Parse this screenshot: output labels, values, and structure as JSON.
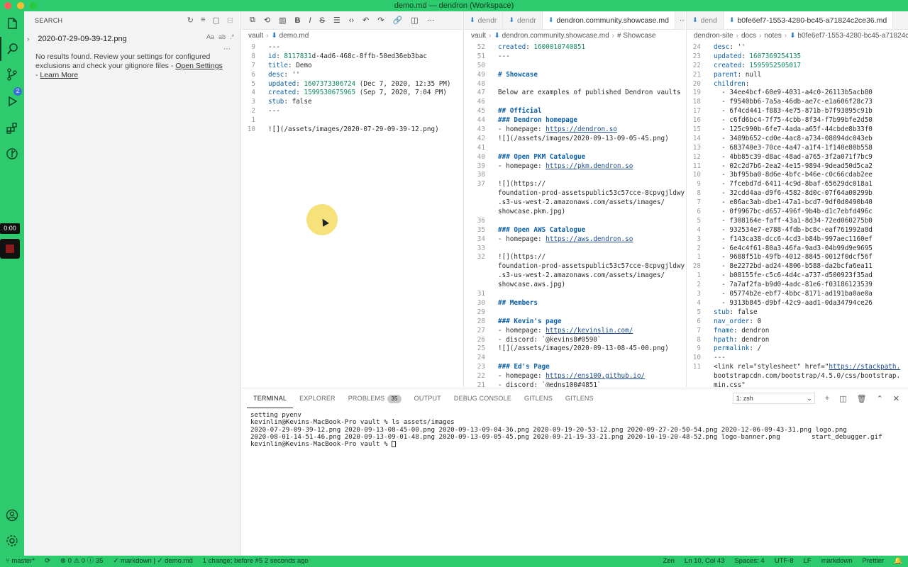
{
  "window": {
    "title": "demo.md — dendron (Workspace)"
  },
  "colors": {
    "accent": "#2dca6e",
    "badge": "#3b6fd4"
  },
  "activity": {
    "icons": [
      "files-icon",
      "search-icon",
      "source-control-icon",
      "run-debug-icon",
      "extensions-icon",
      "git-graph-icon",
      "account-icon",
      "settings-icon"
    ],
    "source_control_badge": "2"
  },
  "recorder": {
    "time": "0:00"
  },
  "sidebar": {
    "title": "SEARCH",
    "query": "2020-07-29-09-39-12.png",
    "option_labels": [
      "Aa",
      "ab",
      ".*"
    ],
    "message_before": "No results found. Review your settings for configured exclusions and check your gitignore files - ",
    "open_settings": "Open Settings",
    "message_dash": " - ",
    "learn_more": "Learn More"
  },
  "editor1": {
    "breadcrumb": [
      "vault",
      "demo.md"
    ],
    "lines": [
      {
        "n": "9",
        "t": "---"
      },
      {
        "n": "8",
        "t": "id: 8117831d-4ad6-468c-8ffb-50ed36eb3bac"
      },
      {
        "n": "7",
        "t": "title: Demo"
      },
      {
        "n": "6",
        "t": "desc: ''"
      },
      {
        "n": "5",
        "t": "updated: 1607373306724 (Dec 7, 2020, 12:35 PM)"
      },
      {
        "n": "4",
        "t": "created: 1599530675965 (Sep 7, 2020, 7:04 PM)"
      },
      {
        "n": "3",
        "t": "stub: false"
      },
      {
        "n": "2",
        "t": "---"
      },
      {
        "n": "1",
        "t": ""
      },
      {
        "n": "10",
        "t": "![](/assets/images/2020-07-29-09-39-12.png)"
      }
    ]
  },
  "editor2": {
    "tabs": [
      "dendr",
      "dendr",
      "dendron.community.showcase.md"
    ],
    "breadcrumb": [
      "vault",
      "dendron.community.showcase.md",
      "# Showcase"
    ],
    "lines": [
      {
        "n": "52",
        "t": "created: 1600010740851"
      },
      {
        "n": "51",
        "t": "---"
      },
      {
        "n": "50",
        "t": ""
      },
      {
        "n": "49",
        "t": "# Showcase"
      },
      {
        "n": "48",
        "t": ""
      },
      {
        "n": "47",
        "t": "Below are examples of published Dendron vaults"
      },
      {
        "n": "46",
        "t": ""
      },
      {
        "n": "45",
        "t": "## Official"
      },
      {
        "n": "44",
        "t": "### Dendron homepage"
      },
      {
        "n": "43",
        "t": "- homepage: https://dendron.so"
      },
      {
        "n": "42",
        "t": "![](/assets/images/2020-09-13-09-05-45.png)"
      },
      {
        "n": "41",
        "t": ""
      },
      {
        "n": "40",
        "t": "### Open PKM Catalogue"
      },
      {
        "n": "39",
        "t": "- homepage: https://pkm.dendron.so"
      },
      {
        "n": "38",
        "t": ""
      },
      {
        "n": "37",
        "t": "![](https://"
      },
      {
        "n": "",
        "t": "foundation-prod-assetspublic53c57cce-8cpvgjldwysl"
      },
      {
        "n": "",
        "t": ".s3-us-west-2.amazonaws.com/assets/images/"
      },
      {
        "n": "",
        "t": "showcase.pkm.jpg)"
      },
      {
        "n": "36",
        "t": ""
      },
      {
        "n": "35",
        "t": "### Open AWS Catalogue"
      },
      {
        "n": "34",
        "t": "- homepage: https://aws.dendron.so"
      },
      {
        "n": "33",
        "t": ""
      },
      {
        "n": "32",
        "t": "![](https://"
      },
      {
        "n": "",
        "t": "foundation-prod-assetspublic53c57cce-8cpvgjldwysl"
      },
      {
        "n": "",
        "t": ".s3-us-west-2.amazonaws.com/assets/images/"
      },
      {
        "n": "",
        "t": "showcase.aws.jpg)"
      },
      {
        "n": "31",
        "t": ""
      },
      {
        "n": "30",
        "t": "## Members"
      },
      {
        "n": "29",
        "t": ""
      },
      {
        "n": "28",
        "t": "### Kevin's page"
      },
      {
        "n": "27",
        "t": "- homepage: https://kevinslin.com/"
      },
      {
        "n": "26",
        "t": "- discord: `@kevins8#0590`"
      },
      {
        "n": "25",
        "t": "![](/assets/images/2020-09-13-08-45-00.png)"
      },
      {
        "n": "24",
        "t": ""
      },
      {
        "n": "23",
        "t": "### Ed's Page"
      },
      {
        "n": "22",
        "t": "- homepage: https://ens100.github.io/"
      },
      {
        "n": "21",
        "t": "- discord: `@edns100#4851`"
      }
    ]
  },
  "editor3": {
    "tabs": [
      "dend",
      "b0fe6ef7-1553-4280-bc45-a71824c2ce36.md"
    ],
    "breadcrumb": [
      "dendron-site",
      "docs",
      "notes",
      "b0fe6ef7-1553-4280-bc45-a71824c2ce36.md"
    ],
    "lines": [
      {
        "n": "24",
        "t": "desc: ''"
      },
      {
        "n": "23",
        "t": "updated: 1607369254135"
      },
      {
        "n": "22",
        "t": "created: 1595952505017"
      },
      {
        "n": "21",
        "t": "parent: null"
      },
      {
        "n": "20",
        "t": "children:"
      },
      {
        "n": "19",
        "t": "  - 34ee4bcf-60e9-4031-a4c0-26113b5acb80"
      },
      {
        "n": "18",
        "t": "  - f9540bb6-7a5a-46db-ae7c-e1a606f28c73"
      },
      {
        "n": "17",
        "t": "  - 6f4cd441-f883-4e75-871b-b7f93895c91b"
      },
      {
        "n": "16",
        "t": "  - c6fd6bc4-7f75-4cbb-8f34-f7b99bfe2d50"
      },
      {
        "n": "15",
        "t": "  - 125c990b-6fe7-4ada-a65f-44cbde8b33f0"
      },
      {
        "n": "14",
        "t": "  - 3489b652-cd0e-4ac8-a734-08094dc043eb"
      },
      {
        "n": "13",
        "t": "  - 683740e3-70ce-4a47-a1f4-1f140e80b558"
      },
      {
        "n": "12",
        "t": "  - 4bb85c39-d8ac-48ad-a765-3f2a071f7bc9"
      },
      {
        "n": "11",
        "t": "  - 02c2d7b6-2ea2-4e15-9894-9dead50d5ca2"
      },
      {
        "n": "10",
        "t": "  - 3bf95ba0-8d6e-4bfc-b46e-c0c66cdab2ee"
      },
      {
        "n": "9",
        "t": "  - 7fcebd7d-6411-4c9d-8baf-65629dc018a1"
      },
      {
        "n": "8",
        "t": "  - 32cdd4aa-d9f6-4582-8d0c-07f64a00299b"
      },
      {
        "n": "7",
        "t": "  - e86ac3ab-dbe1-47a1-bcd7-9df0d0490b40"
      },
      {
        "n": "6",
        "t": "  - 0f9967bc-d657-496f-9b4b-d1c7ebfd496c"
      },
      {
        "n": "5",
        "t": "  - f308164e-faff-43a1-8d34-72ed060275b0"
      },
      {
        "n": "4",
        "t": "  - 932534e7-e788-4fdb-bc8c-eaf761992a8d"
      },
      {
        "n": "3",
        "t": "  - f143ca38-dcc6-4cd3-b84b-997aec1160ef"
      },
      {
        "n": "2",
        "t": "  - 6e4c4f61-80a3-46fa-9ad3-04b99d9e9695"
      },
      {
        "n": "1",
        "t": "  - 9688f51b-49fb-4012-8845-0012f0dcf56f"
      },
      {
        "n": "28",
        "t": "  - 8e2272bd-ad24-4806-b588-da2bcfa6ea11"
      },
      {
        "n": "1",
        "t": "  - b08155fe-c5c6-4d4c-a737-d500923f35ad"
      },
      {
        "n": "2",
        "t": "  - 7a7af2fa-b9d0-4adc-81e6-f03186123539"
      },
      {
        "n": "3",
        "t": "  - 05774b2e-ebf7-4bbc-8171-ad191ba0ae0a"
      },
      {
        "n": "4",
        "t": "  - 9313b845-d9bf-42c9-aad1-0da34794ce26"
      },
      {
        "n": "5",
        "t": "stub: false"
      },
      {
        "n": "6",
        "t": "nav_order: 0"
      },
      {
        "n": "7",
        "t": "fname: dendron"
      },
      {
        "n": "8",
        "t": "hpath: dendron"
      },
      {
        "n": "9",
        "t": "permalink: /"
      },
      {
        "n": "10",
        "t": "---"
      },
      {
        "n": "11",
        "t": "<link rel=\"stylesheet\" href=\"https://stackpath."
      },
      {
        "n": "",
        "t": "bootstrapcdn.com/bootstrap/4.5.0/css/bootstrap."
      },
      {
        "n": "",
        "t": "min.css\""
      }
    ]
  },
  "panel": {
    "tabs": [
      "TERMINAL",
      "EXPLORER",
      "PROBLEMS",
      "OUTPUT",
      "DEBUG CONSOLE",
      "GITLENS",
      "GITLENS"
    ],
    "problems_count": "35",
    "shell": "1: zsh",
    "terminal_lines": [
      "setting pyenv",
      "kevinlin@Kevins-MacBook-Pro vault % ls assets/images",
      "2020-07-29-09-39-12.png 2020-09-13-08-45-00.png 2020-09-13-09-04-36.png 2020-09-19-20-53-12.png 2020-09-27-20-50-54.png 2020-12-06-09-43-31.png logo.png",
      "2020-08-01-14-51-46.png 2020-09-13-09-01-48.png 2020-09-13-09-05-45.png 2020-09-21-19-33-21.png 2020-10-19-20-48-52.png logo-banner.png        start_debugger.gif",
      "kevinlin@Kevins-MacBook-Pro vault % "
    ]
  },
  "status": {
    "branch": "master*",
    "sync": "⟳",
    "problems": "⊗ 0 ⚠ 0 ⓘ 35",
    "language": "✓ markdown | ✓ demo.md",
    "change": "1 change; before #5  2 seconds ago",
    "zen": "Zen",
    "position": "Ln 10, Col 43",
    "spaces": "Spaces: 4",
    "encoding": "UTF-8",
    "eol": "LF",
    "mode": "markdown",
    "formatter": "Prettier"
  }
}
